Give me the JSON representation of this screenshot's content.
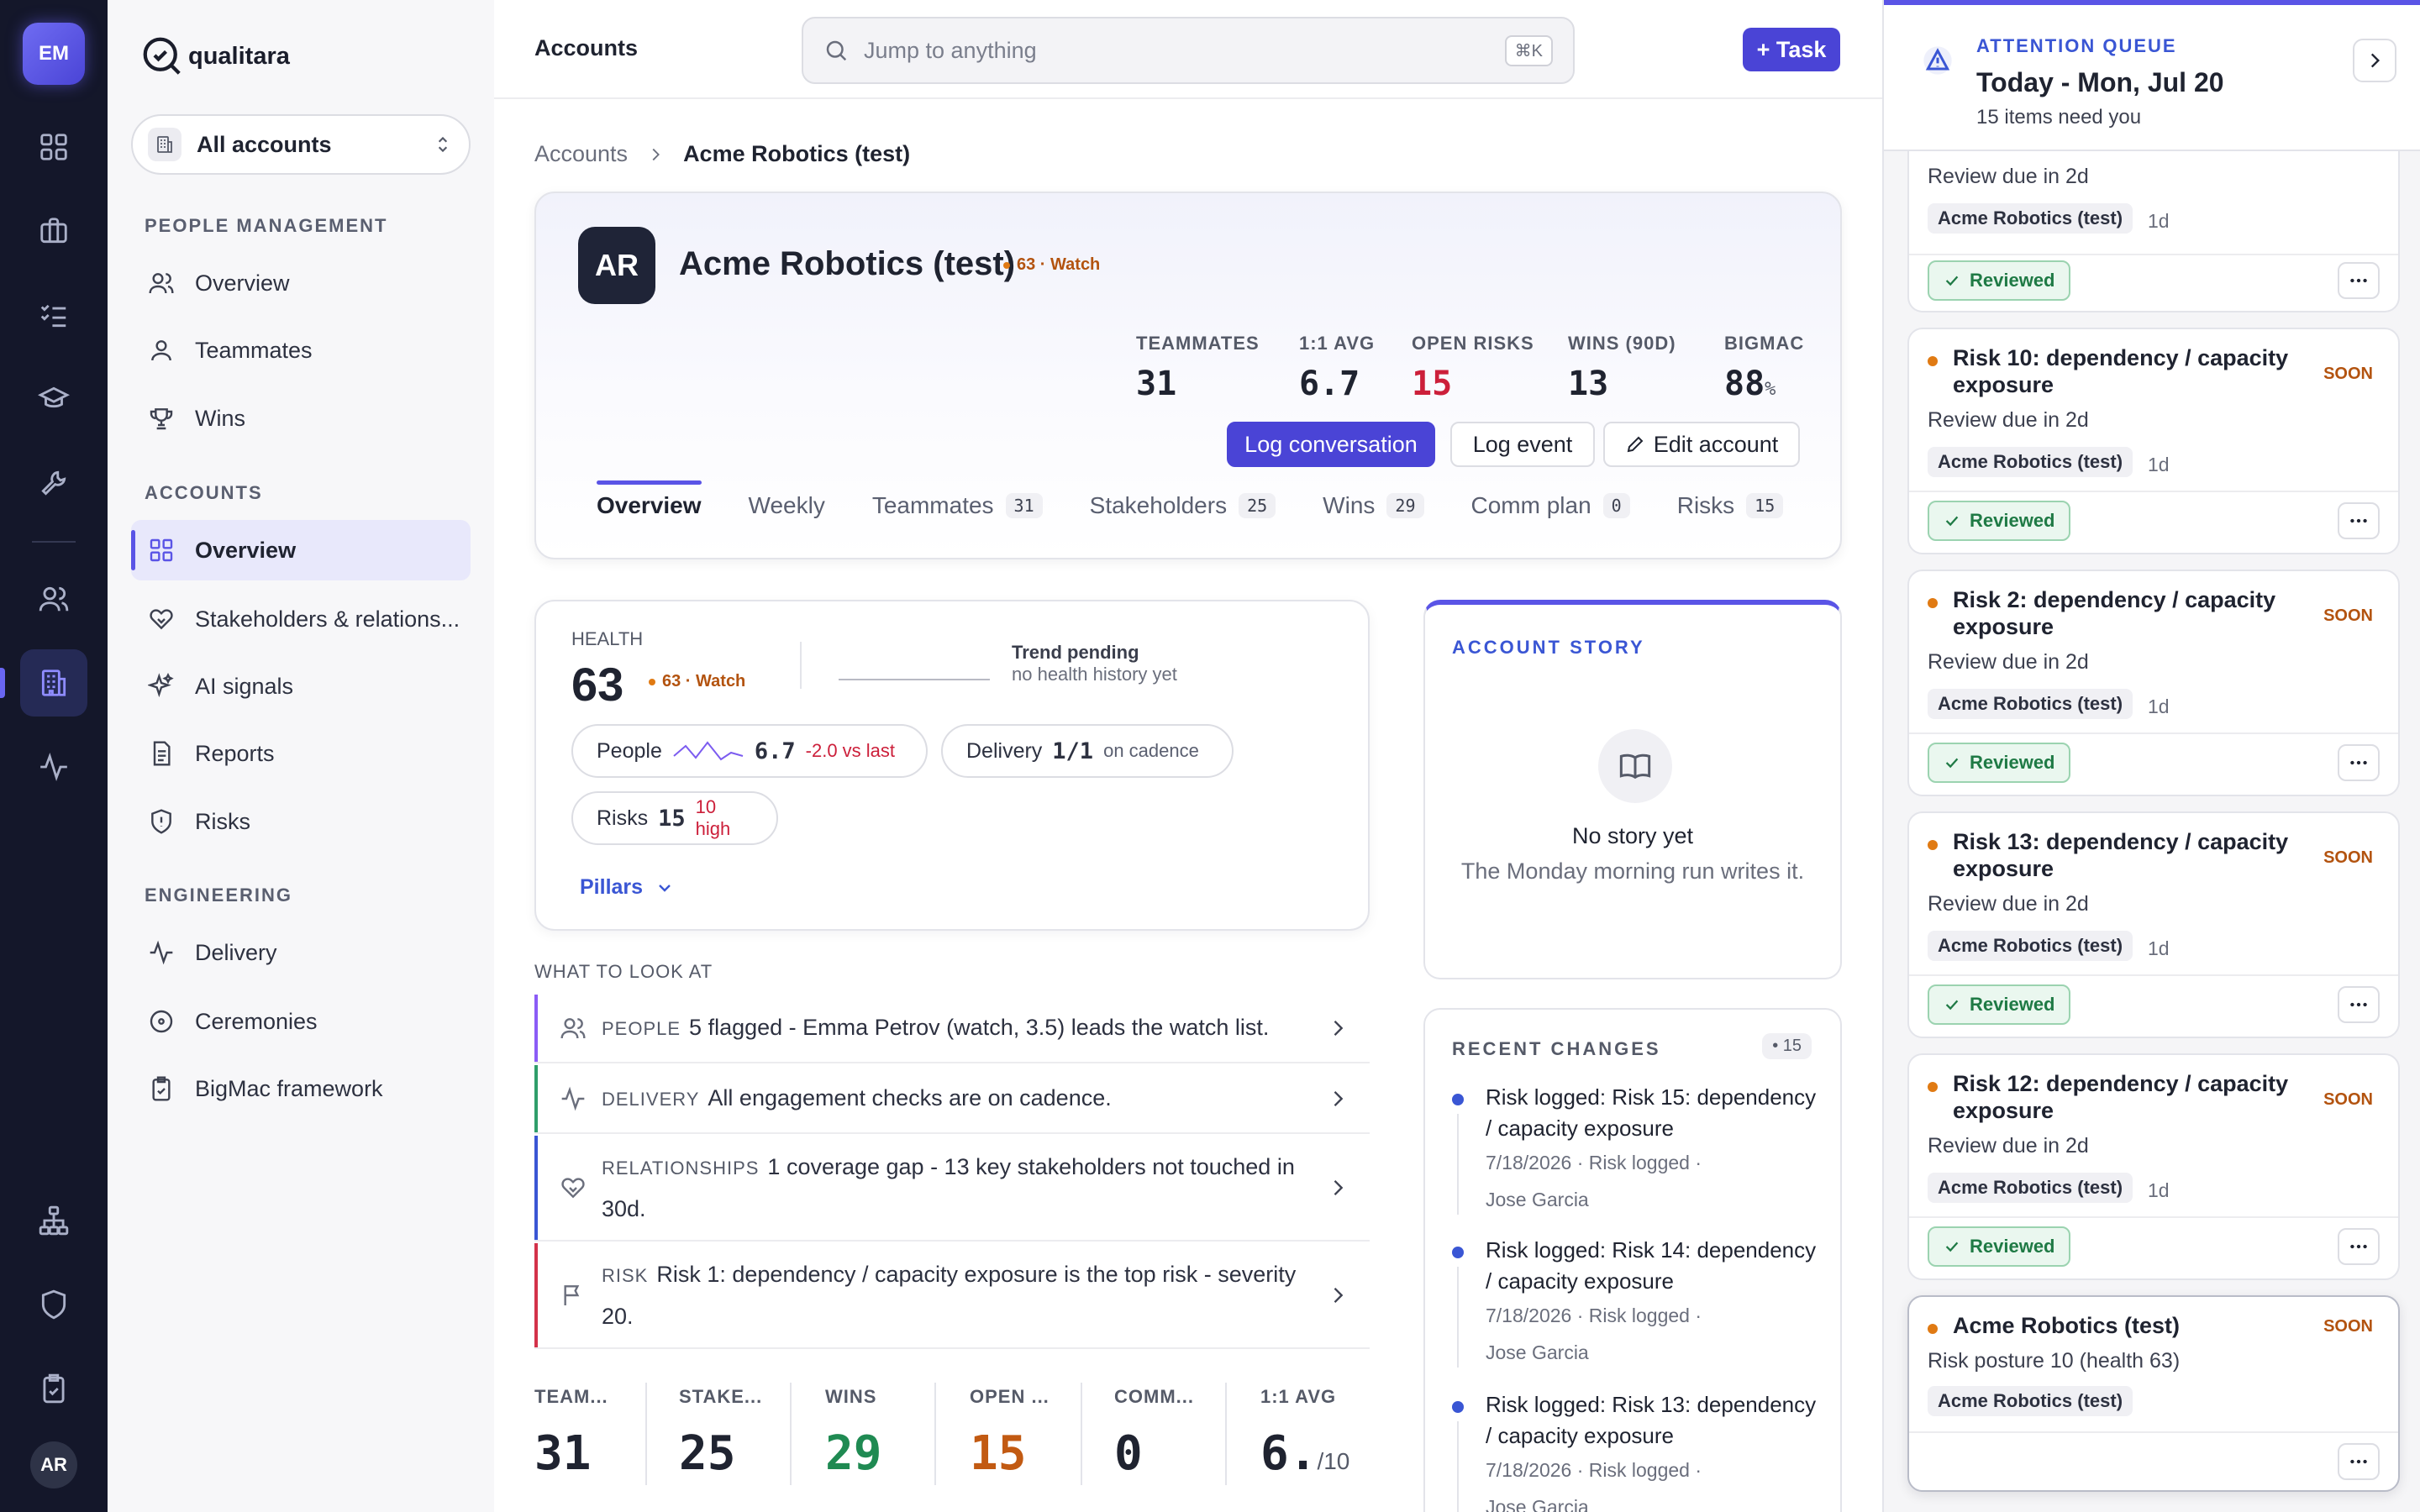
{
  "rail": {
    "user_initials": "EM",
    "me_initials": "AR"
  },
  "brand": {
    "name": "qualitara"
  },
  "account_switcher": {
    "label": "All accounts"
  },
  "sections": {
    "people": "PEOPLE MANAGEMENT",
    "accounts": "ACCOUNTS",
    "engineering": "ENGINEERING"
  },
  "nav": {
    "people": [
      "Overview",
      "Teammates",
      "Wins"
    ],
    "accounts": [
      "Overview",
      "Stakeholders & relations...",
      "AI signals",
      "Reports",
      "Risks"
    ],
    "engineering": [
      "Delivery",
      "Ceremonies",
      "BigMac framework"
    ]
  },
  "header": {
    "title": "Accounts",
    "search_placeholder": "Jump to anything",
    "shortcut": "⌘K",
    "task_button": "+ Task"
  },
  "breadcrumb": {
    "root": "Accounts",
    "current": "Acme Robotics (test)"
  },
  "account": {
    "initials": "AR",
    "name": "Acme Robotics (test)",
    "health_pill": "63 · Watch",
    "stats": [
      {
        "label": "TEAMMATES",
        "value": "31"
      },
      {
        "label": "1:1 AVG",
        "value": "6.7"
      },
      {
        "label": "OPEN RISKS",
        "value": "15"
      },
      {
        "label": "WINS (90D)",
        "value": "13"
      },
      {
        "label": "BIGMAC",
        "value": "88",
        "unit": "%"
      }
    ],
    "buttons": {
      "log_conversation": "Log conversation",
      "log_event": "Log event",
      "edit_account": "Edit account"
    },
    "tabs": [
      {
        "label": "Overview",
        "count": ""
      },
      {
        "label": "Weekly",
        "count": ""
      },
      {
        "label": "Teammates",
        "count": "31"
      },
      {
        "label": "Stakeholders",
        "count": "25"
      },
      {
        "label": "Wins",
        "count": "29"
      },
      {
        "label": "Comm plan",
        "count": "0"
      },
      {
        "label": "Risks",
        "count": "15"
      }
    ]
  },
  "health": {
    "label": "HEALTH",
    "score": "63",
    "pill": "63 · Watch",
    "trend_title": "Trend pending",
    "trend_sub": "no health history yet",
    "people": {
      "label": "People",
      "value": "6.7",
      "delta": "-2.0 vs last"
    },
    "delivery": {
      "label": "Delivery",
      "value": "1/1",
      "note": "on cadence"
    },
    "risks": {
      "label": "Risks",
      "value": "15",
      "note": "10 high"
    },
    "pillars": "Pillars"
  },
  "look_at": {
    "heading": "WHAT TO LOOK AT",
    "items": [
      {
        "tag": "PEOPLE",
        "text": "5 flagged - Emma Petrov (watch, 3.5) leads the watch list.",
        "color": "#8b5cf6"
      },
      {
        "tag": "DELIVERY",
        "text": "All engagement checks are on cadence.",
        "color": "#2f9e6a"
      },
      {
        "tag": "RELATIONSHIPS",
        "text": "1 coverage gap - 13 key stakeholders not touched in 30d.",
        "color": "#3a56d4"
      },
      {
        "tag": "RISK",
        "text": "Risk 1: dependency / capacity exposure is the top risk - severity 20.",
        "color": "#d3324a"
      }
    ]
  },
  "bottom_stats": [
    {
      "label": "TEAM...",
      "value": "31",
      "color": "#1f2330"
    },
    {
      "label": "STAKE...",
      "value": "25",
      "color": "#1f2330"
    },
    {
      "label": "WINS",
      "value": "29",
      "color": "#1f8a52"
    },
    {
      "label": "OPEN ...",
      "value": "15",
      "color": "#c25a12"
    },
    {
      "label": "COMM...",
      "value": "0",
      "color": "#1f2330"
    },
    {
      "label": "1:1 AVG",
      "value": "6.",
      "suffix": "/10",
      "color": "#1f2330"
    }
  ],
  "story": {
    "heading": "ACCOUNT STORY",
    "empty_title": "No story yet",
    "empty_sub": "The Monday morning run writes it."
  },
  "recent": {
    "heading": "RECENT CHANGES",
    "count": "• 15",
    "items": [
      {
        "title": "Risk logged: Risk 15: dependency / capacity exposure",
        "date": "7/18/2026",
        "type": "Risk logged",
        "who": "Jose Garcia"
      },
      {
        "title": "Risk logged: Risk 14: dependency / capacity exposure",
        "date": "7/18/2026",
        "type": "Risk logged",
        "who": "Jose Garcia"
      },
      {
        "title": "Risk logged: Risk 13: dependency / capacity exposure",
        "date": "7/18/2026",
        "type": "Risk logged",
        "who": "Jose Garcia"
      }
    ]
  },
  "queue": {
    "kicker": "ATTENTION QUEUE",
    "date": "Today - Mon, Jul 20",
    "count": "15 items need you",
    "partial": {
      "due": "Review due in 2d",
      "account": "Acme Robotics (test)",
      "age": "1d",
      "reviewed": "Reviewed"
    },
    "items": [
      {
        "title": "Risk 10: dependency / capacity exposure",
        "badge": "SOON",
        "due": "Review due in 2d",
        "account": "Acme Robotics (test)",
        "age": "1d",
        "reviewed": "Reviewed"
      },
      {
        "title": "Risk 2: dependency / capacity exposure",
        "badge": "SOON",
        "due": "Review due in 2d",
        "account": "Acme Robotics (test)",
        "age": "1d",
        "reviewed": "Reviewed"
      },
      {
        "title": "Risk 13: dependency / capacity exposure",
        "badge": "SOON",
        "due": "Review due in 2d",
        "account": "Acme Robotics (test)",
        "age": "1d",
        "reviewed": "Reviewed"
      },
      {
        "title": "Risk 12: dependency / capacity exposure",
        "badge": "SOON",
        "due": "Review due in 2d",
        "account": "Acme Robotics (test)",
        "age": "1d",
        "reviewed": "Reviewed"
      }
    ],
    "last": {
      "title": "Acme Robotics (test)",
      "badge": "SOON",
      "due": "Risk posture 10 (health 63)",
      "account": "Acme Robotics (test)"
    }
  }
}
